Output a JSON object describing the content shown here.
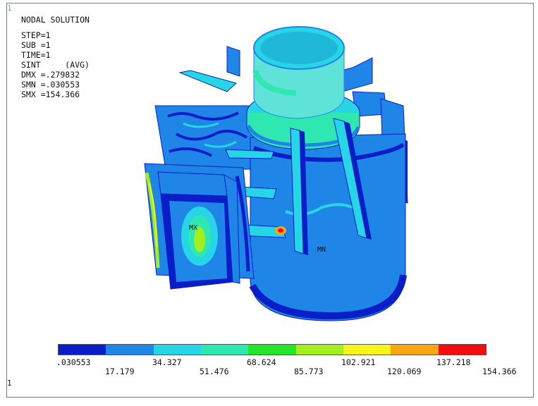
{
  "window_number_top": "1",
  "window_number_bottom": "1",
  "title": "NODAL SOLUTION",
  "info_lines": [
    "STEP=1",
    "SUB =1",
    "TIME=1",
    "SINT     (AVG)",
    "DMX =.279832",
    "SMN =.030553",
    "SMX =154.366"
  ],
  "markers": {
    "max": "MX",
    "min": "MN"
  },
  "legend": {
    "colors": [
      "#0a1ec8",
      "#1f86e8",
      "#27d6e6",
      "#2fe7b0",
      "#25e52a",
      "#a2ee1e",
      "#f6f418",
      "#f9a612",
      "#f40d0d"
    ],
    "labels_top": [
      ".030553",
      "34.327",
      "68.624",
      "102.921",
      "137.218"
    ],
    "labels_bottom": [
      "17.179",
      "51.476",
      "85.773",
      "120.069",
      "154.366"
    ]
  }
}
